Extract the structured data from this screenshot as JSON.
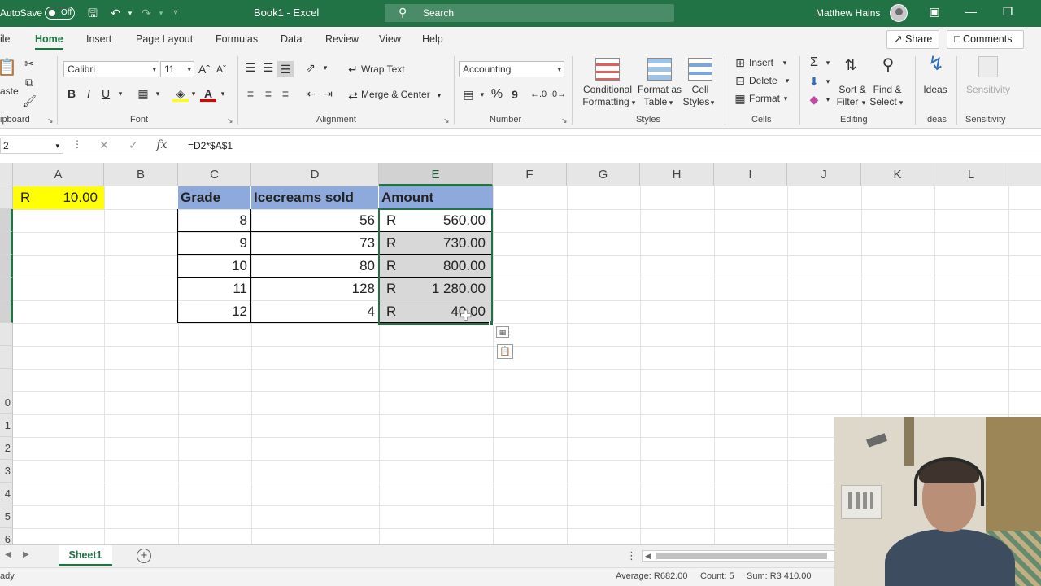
{
  "titlebar": {
    "autosave_label": "AutoSave",
    "autosave_state": "Off",
    "doc_title": "Book1  -  Excel",
    "search_placeholder": "Search",
    "user_name": "Matthew Hains"
  },
  "ribbon_tabs": [
    "ile",
    "Home",
    "Insert",
    "Page Layout",
    "Formulas",
    "Data",
    "Review",
    "View",
    "Help"
  ],
  "share_label": "Share",
  "comments_label": "Comments",
  "ribbon": {
    "clipboard": {
      "label": "ipboard",
      "paste": "aste"
    },
    "font": {
      "label": "Font",
      "name": "Calibri",
      "size": "11",
      "bold": "B",
      "italic": "I",
      "underline": "U"
    },
    "alignment": {
      "label": "Alignment",
      "wrap_text": "Wrap Text",
      "merge_center": "Merge & Center"
    },
    "number": {
      "label": "Number",
      "format": "Accounting",
      "percent": "%",
      "comma": "9"
    },
    "styles": {
      "label": "Styles",
      "conditional_1": "Conditional",
      "conditional_2": "Formatting",
      "format_table_1": "Format as",
      "format_table_2": "Table",
      "cell_styles_1": "Cell",
      "cell_styles_2": "Styles"
    },
    "cells": {
      "label": "Cells",
      "insert": "Insert",
      "delete": "Delete",
      "format": "Format"
    },
    "editing": {
      "label": "Editing",
      "sort_1": "Sort &",
      "sort_2": "Filter",
      "find_1": "Find &",
      "find_2": "Select"
    },
    "ideas": {
      "label": "Ideas",
      "button": "Ideas"
    },
    "sensitivity": {
      "label": "Sensitivity",
      "button": "Sensitivity"
    }
  },
  "formula_bar": {
    "name_box": "2",
    "fx": "fx",
    "formula": "=D2*$A$1"
  },
  "columns": [
    "A",
    "B",
    "C",
    "D",
    "E",
    "F",
    "G",
    "H",
    "I",
    "J",
    "K",
    "L"
  ],
  "rows": [
    "",
    "",
    "",
    "",
    "",
    "",
    "",
    "",
    "",
    "0",
    "1",
    "2",
    "3",
    "4",
    "5",
    "6"
  ],
  "cells": {
    "a1_symbol": "R",
    "a1_value": "10.00",
    "c1": "Grade",
    "d1": "Icecreams sold",
    "e1": "Amount",
    "table": [
      {
        "grade": "8",
        "sold": "56",
        "symbol": "R",
        "amount": "560.00"
      },
      {
        "grade": "9",
        "sold": "73",
        "symbol": "R",
        "amount": "730.00"
      },
      {
        "grade": "10",
        "sold": "80",
        "symbol": "R",
        "amount": "800.00"
      },
      {
        "grade": "11",
        "sold": "128",
        "symbol": "R",
        "amount": "1 280.00"
      },
      {
        "grade": "12",
        "sold": "4",
        "symbol": "R",
        "amount": "40.00"
      }
    ]
  },
  "sheet_tab": "Sheet1",
  "status": {
    "mode": "ady",
    "average": "Average: R682.00",
    "count": "Count: 5",
    "sum": "Sum: R3 410.00"
  },
  "colors": {
    "excel_green": "#217346",
    "header_fill": "#8ea9db",
    "highlight_yellow": "#ffff00"
  }
}
